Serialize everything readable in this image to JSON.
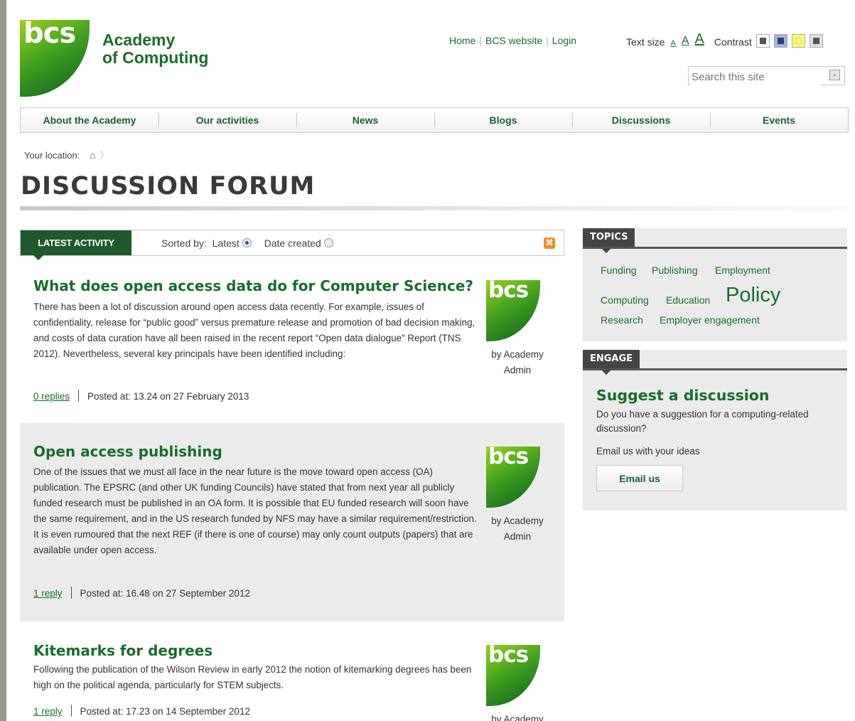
{
  "site": {
    "logo_text": "bcs",
    "brand_line1": "Academy",
    "brand_line2": "of Computing"
  },
  "toplinks": [
    "Home",
    "BCS website",
    "Login"
  ],
  "textsize": {
    "label": "Text size",
    "sizes": [
      "A",
      "A",
      "A"
    ]
  },
  "contrast": {
    "label": "Contrast",
    "colors": [
      "#ffffff",
      "#9fb8d8",
      "#ffff66",
      "#e0e0e0"
    ]
  },
  "search": {
    "placeholder": "Search this site"
  },
  "nav": [
    "About the Academy",
    "Our activities",
    "News",
    "Blogs",
    "Discussions",
    "Events"
  ],
  "breadcrumb": {
    "label": "Your location:"
  },
  "page_title": "DISCUSSION FORUM",
  "activity": {
    "tab": "LATEST ACTIVITY",
    "sorted_label": "Sorted by:",
    "options": [
      "Latest",
      "Date created"
    ],
    "selected": "Latest"
  },
  "posts": [
    {
      "title": "What does open access data do for Computer Science?",
      "body": "There has been a lot of discussion around open access data recently. For example, issues of confidentiality, release for “public good” versus premature release and promotion of bad decision making, and costs of data curation have all been raised in the recent report “Open data dialogue” Report (TNS 2012). Nevertheless, several key principals have been identified including:",
      "replies": "0 replies",
      "posted": "Posted at: 13.24 on 27 February 2013",
      "author": "by Academy Admin"
    },
    {
      "title": "Open access publishing",
      "body": "One of the issues that we must all face in the near future is the move toward open access (OA) publication. The EPSRC (and other UK funding Councils) have stated that from next year all publicly funded research must be published in an OA form. It is possible that EU funded research will soon have the same requirement, and in the US research funded by NFS may have a similar requirement/restriction. It is even rumoured that the next REF (if there is one of course) may only count outputs (papers) that are available under open access.",
      "replies": "1 reply",
      "posted": "Posted at: 16.48 on 27 September 2012",
      "author": "by Academy Admin"
    },
    {
      "title": "Kitemarks for degrees",
      "body": "Following the publication of the Wilson Review in early 2012 the notion of kitemarking degrees has been high on the political agenda, particularly for STEM subjects.",
      "replies": "1 reply",
      "posted": "Posted at: 17.23 on 14 September 2012",
      "author": "by Academy"
    }
  ],
  "topics": {
    "heading": "TOPICS",
    "tags": [
      "Funding",
      "Publishing",
      "Employment",
      "Computing",
      "Education",
      "Policy",
      "Research",
      "Employer engagement"
    ]
  },
  "engage": {
    "heading": "ENGAGE",
    "title": "Suggest a discussion",
    "text": "Do you have a suggestion for a computing-related discussion?",
    "email_text": "Email us with your ideas",
    "button": "Email us"
  },
  "colors": {
    "brand_green": "#1b6c2d",
    "nav_green": "#1f5a2c",
    "panel_bg": "#ebebeb"
  }
}
